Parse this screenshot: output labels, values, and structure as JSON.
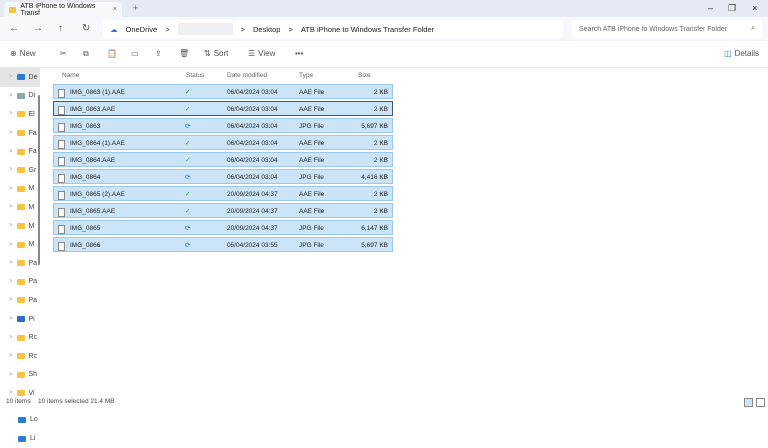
{
  "window": {
    "tab_title": "ATB iPhone to Windows Transf",
    "tab_close": "×",
    "new_tab": "+",
    "minimize": "–",
    "maximize": "❐",
    "close": "×"
  },
  "address": {
    "back": "←",
    "forward": "→",
    "up": "↑",
    "refresh": "↻",
    "crumbs": [
      "OneDrive",
      "Desktop",
      "ATB iPhone to Windows Transfer Folder"
    ],
    "sep": ">",
    "search_placeholder": "Search ATB iPhone to Windows Transfer Folder",
    "search_icon": "⌕"
  },
  "toolbar": {
    "new": "New",
    "sort": "Sort",
    "view": "View",
    "more": "•••",
    "details": "Details"
  },
  "sidebar": {
    "items": [
      "De",
      "Di",
      "El",
      "Fa",
      "Fa",
      "Gr",
      "M",
      "M",
      "M",
      "M",
      "Pa",
      "Pa",
      "Pa",
      "Pi",
      "Rc",
      "Rc",
      "Sh",
      "Vi"
    ],
    "bottom": [
      "Lo",
      "Li"
    ]
  },
  "columns": {
    "name": "Name",
    "status": "Status",
    "date": "Date modified",
    "type": "Type",
    "size": "Size"
  },
  "files": [
    {
      "name": "IMG_0863 (1).AAE",
      "status": "✓",
      "date": "06/04/2024 03:04",
      "type": "AAE File",
      "size": "2 KB",
      "kind": "aae"
    },
    {
      "name": "IMG_0863.AAE",
      "status": "✓",
      "date": "06/04/2024 03:04",
      "type": "AAE File",
      "size": "2 KB",
      "kind": "aae"
    },
    {
      "name": "IMG_0863",
      "status": "⟳",
      "date": "06/04/2024 03:04",
      "type": "JPG File",
      "size": "5,697 KB",
      "kind": "jpg"
    },
    {
      "name": "IMG_0864 (1).AAE",
      "status": "✓",
      "date": "06/04/2024 03:04",
      "type": "AAE File",
      "size": "2 KB",
      "kind": "aae"
    },
    {
      "name": "IMG_0864.AAE",
      "status": "✓",
      "date": "06/04/2024 03:04",
      "type": "AAE File",
      "size": "2 KB",
      "kind": "aae"
    },
    {
      "name": "IMG_0864",
      "status": "⟳",
      "date": "06/04/2024 03:04",
      "type": "JPG File",
      "size": "4,416 KB",
      "kind": "jpg"
    },
    {
      "name": "IMG_0865 (2).AAE",
      "status": "✓",
      "date": "20/09/2024 04:37",
      "type": "AAE File",
      "size": "2 KB",
      "kind": "aae"
    },
    {
      "name": "IMG_0865.AAE",
      "status": "✓",
      "date": "20/09/2024 04:37",
      "type": "AAE File",
      "size": "2 KB",
      "kind": "aae"
    },
    {
      "name": "IMG_0865",
      "status": "⟳",
      "date": "20/09/2024 04:37",
      "type": "JPG File",
      "size": "6,147 KB",
      "kind": "jpg"
    },
    {
      "name": "IMG_0866",
      "status": "⟳",
      "date": "05/04/2024 03:55",
      "type": "JPG File",
      "size": "5,697 KB",
      "kind": "jpg"
    }
  ],
  "statusbar": {
    "count": "10 items",
    "selected": "10 items selected  21.4 MB"
  }
}
